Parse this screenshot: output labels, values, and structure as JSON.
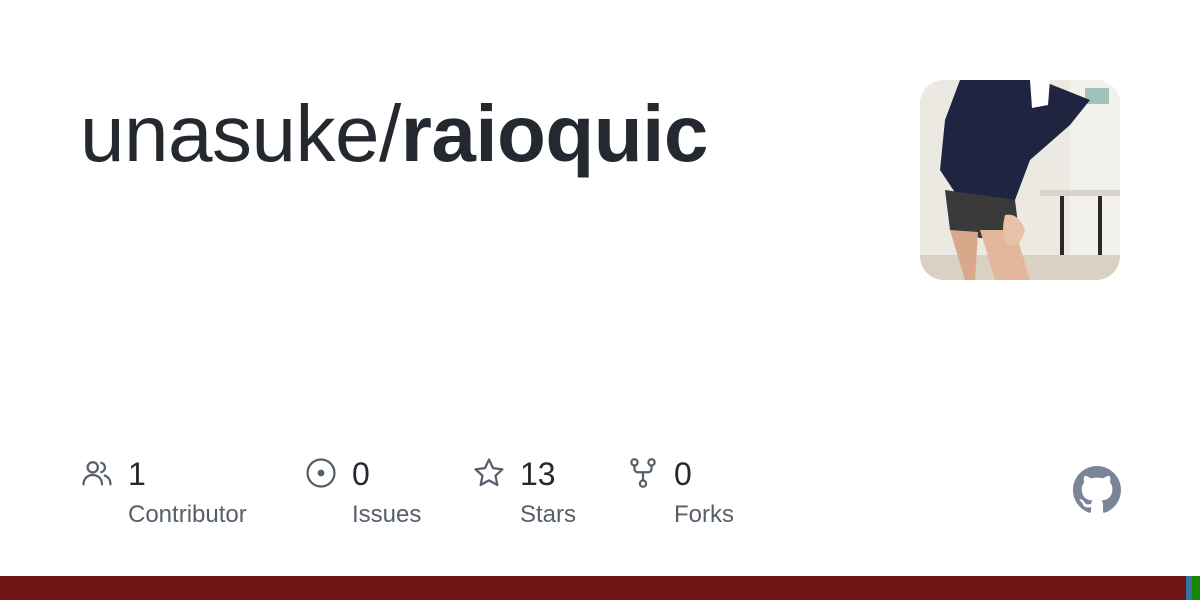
{
  "repo": {
    "owner": "unasuke/",
    "name": "raioquic"
  },
  "avatar": {
    "alt": "repository owner avatar photo",
    "icon": "avatar-photo"
  },
  "stats": [
    {
      "icon": "people-icon",
      "value": "1",
      "label": "Contributor"
    },
    {
      "icon": "issue-opened-icon",
      "value": "0",
      "label": "Issues"
    },
    {
      "icon": "star-icon",
      "value": "13",
      "label": "Stars"
    },
    {
      "icon": "repo-forked-icon",
      "value": "0",
      "label": "Forks"
    }
  ],
  "brand": {
    "icon": "github-mark-icon",
    "color": "#7a8598"
  },
  "colors": {
    "text": "#24292f",
    "muted": "#57606a",
    "icon": "#57606a",
    "language_bar": [
      {
        "language": "Ruby",
        "color": "#701516",
        "share": 0.988
      },
      {
        "language": "Other",
        "color": "#3572a5",
        "share": 0.005
      },
      {
        "language": "Other",
        "color": "#178600",
        "share": 0.007
      }
    ]
  }
}
